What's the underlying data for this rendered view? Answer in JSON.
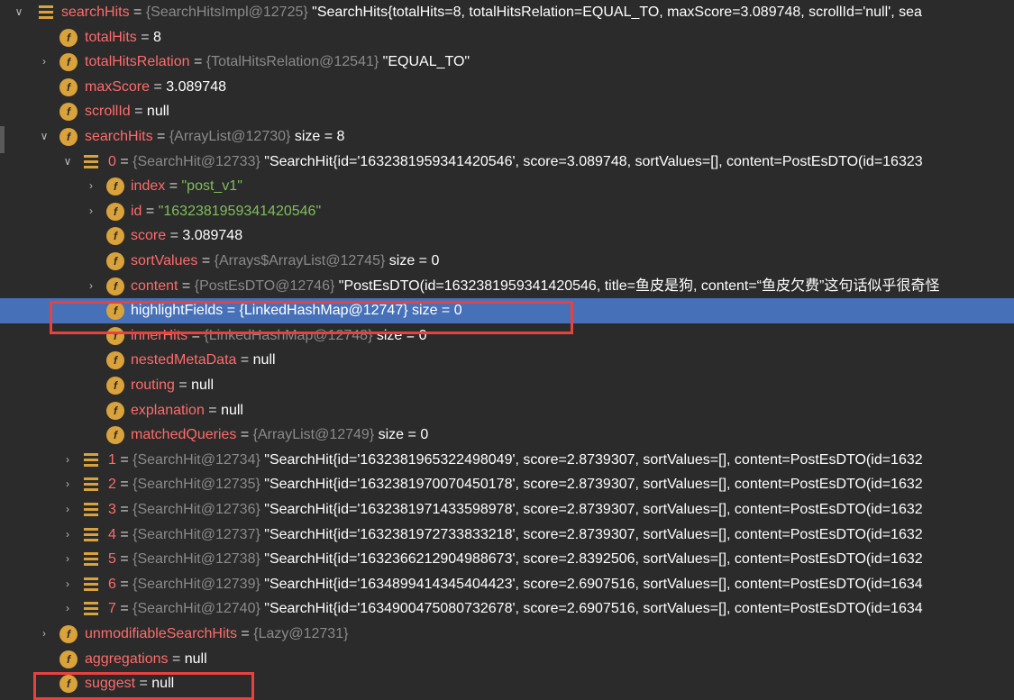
{
  "rows": [
    {
      "name": "searchHits",
      "type": "{SearchHitsImpl@12725}",
      "value": "\"SearchHits{totalHits=8, totalHitsRelation=EQUAL_TO, maxScore=3.089748, scrollId='null', sea"
    },
    {
      "name": "totalHits",
      "value": "8"
    },
    {
      "name": "totalHitsRelation",
      "type": "{TotalHitsRelation@12541}",
      "value": "\"EQUAL_TO\""
    },
    {
      "name": "maxScore",
      "value": "3.089748"
    },
    {
      "name": "scrollId",
      "value": "null"
    },
    {
      "name": "searchHits",
      "type": "{ArrayList@12730}",
      "value": "size = 8"
    },
    {
      "name": "0",
      "type": "{SearchHit@12733}",
      "value": "\"SearchHit{id='1632381959341420546', score=3.089748, sortValues=[], content=PostEsDTO(id=16323"
    },
    {
      "name": "index",
      "value": "\"post_v1\""
    },
    {
      "name": "id",
      "value": "\"1632381959341420546\""
    },
    {
      "name": "score",
      "value": "3.089748"
    },
    {
      "name": "sortValues",
      "type": "{Arrays$ArrayList@12745}",
      "value": "size = 0"
    },
    {
      "name": "content",
      "type": "{PostEsDTO@12746}",
      "value": "\"PostEsDTO(id=1632381959341420546, title=鱼皮是狗, content=“鱼皮欠费”这句话似乎很奇怪"
    },
    {
      "name": "highlightFields",
      "type": "{LinkedHashMap@12747}",
      "value": "size = 0"
    },
    {
      "name": "innerHits",
      "type": "{LinkedHashMap@12748}",
      "value": "size = 0"
    },
    {
      "name": "nestedMetaData",
      "value": "null"
    },
    {
      "name": "routing",
      "value": "null"
    },
    {
      "name": "explanation",
      "value": "null"
    },
    {
      "name": "matchedQueries",
      "type": "{ArrayList@12749}",
      "value": "size = 0"
    },
    {
      "name": "1",
      "type": "{SearchHit@12734}",
      "value": "\"SearchHit{id='1632381965322498049', score=2.8739307, sortValues=[], content=PostEsDTO(id=1632"
    },
    {
      "name": "2",
      "type": "{SearchHit@12735}",
      "value": "\"SearchHit{id='1632381970070450178', score=2.8739307, sortValues=[], content=PostEsDTO(id=1632"
    },
    {
      "name": "3",
      "type": "{SearchHit@12736}",
      "value": "\"SearchHit{id='1632381971433598978', score=2.8739307, sortValues=[], content=PostEsDTO(id=1632"
    },
    {
      "name": "4",
      "type": "{SearchHit@12737}",
      "value": "\"SearchHit{id='1632381972733833218', score=2.8739307, sortValues=[], content=PostEsDTO(id=1632"
    },
    {
      "name": "5",
      "type": "{SearchHit@12738}",
      "value": "\"SearchHit{id='1632366212904988673', score=2.8392506, sortValues=[], content=PostEsDTO(id=1632"
    },
    {
      "name": "6",
      "type": "{SearchHit@12739}",
      "value": "\"SearchHit{id='1634899414345404423', score=2.6907516, sortValues=[], content=PostEsDTO(id=1634"
    },
    {
      "name": "7",
      "type": "{SearchHit@12740}",
      "value": "\"SearchHit{id='1634900475080732678', score=2.6907516, sortValues=[], content=PostEsDTO(id=1634"
    },
    {
      "name": "unmodifiableSearchHits",
      "type": "{Lazy@12731}",
      "value": ""
    },
    {
      "name": "aggregations",
      "value": "null"
    },
    {
      "name": "suggest",
      "value": "null"
    }
  ],
  "glyphs": {
    "expanded": "∨",
    "collapsed": "›",
    "field_icon": "f"
  }
}
